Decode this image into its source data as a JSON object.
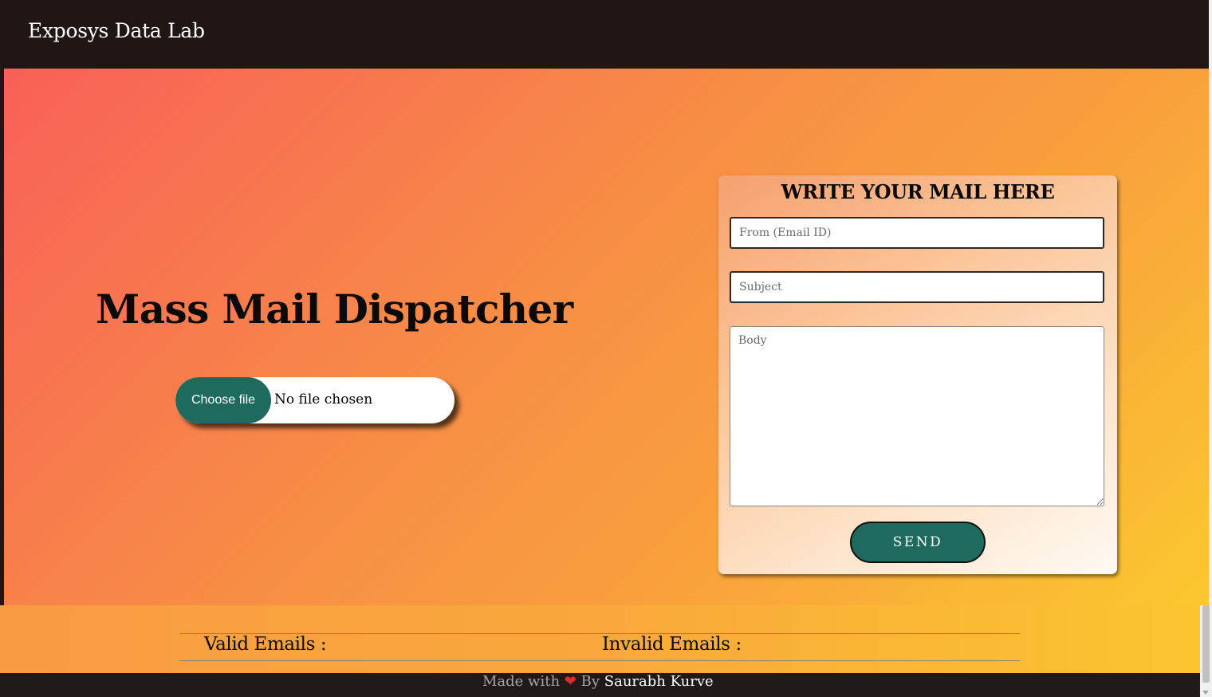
{
  "navbar": {
    "brand": "Exposys Data Lab"
  },
  "hero": {
    "title": "Mass Mail Dispatcher",
    "file_input": {
      "button_label": "Choose file",
      "status": "No file chosen"
    }
  },
  "mail_form": {
    "title": "WRITE YOUR MAIL HERE",
    "from_placeholder": "From (Email ID)",
    "subject_placeholder": "Subject",
    "body_placeholder": "Body",
    "send_label": "SEND"
  },
  "results": {
    "valid_label": "Valid Emails :",
    "invalid_label": "Invalid Emails :"
  },
  "footer": {
    "made_with": "Made with",
    "heart": "❤",
    "by": "By",
    "author": "Saurabh Kurve"
  },
  "colors": {
    "accent": "#1f6a5e",
    "navbar": "#201614",
    "gradient_start": "#f86058",
    "gradient_end": "#fbc82f",
    "heart": "#e12b2b"
  }
}
